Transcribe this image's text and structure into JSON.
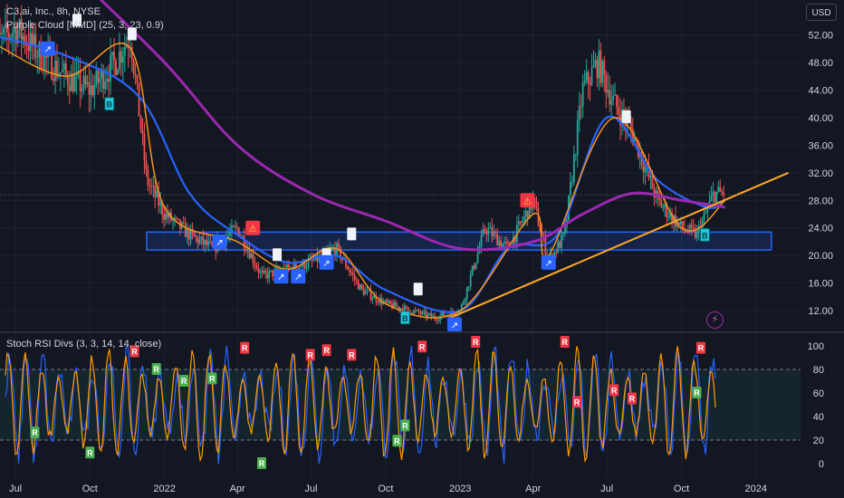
{
  "header": {
    "symbol_line": "C3.ai, Inc., 8h, NYSE",
    "indicator_line": "Purple Cloud [MMD] (25, 3, 23, 0.9)",
    "rsi_line": "Stoch RSI Divs (3, 3, 14, 14, close)"
  },
  "currency_button": "USD",
  "colors": {
    "background": "#131722",
    "up": "#26a69a",
    "down": "#ef5350",
    "blue_line": "#2962ff",
    "orange_line": "#f7931a",
    "purple_line": "#9c27b0",
    "trendline": "#ffa726",
    "zone": "#2962ff",
    "k_line": "#2962ff",
    "d_line": "#ff9800",
    "bull_div": "#4caf50",
    "bear_div": "#f23645"
  },
  "icons": [
    "rocket-icon",
    "bitcoin-icon",
    "lightning-icon"
  ],
  "chart_data": [
    {
      "type": "candlestick",
      "axis": "price",
      "ylim": [
        9,
        56
      ],
      "y_ticks": [
        "52.00",
        "48.00",
        "44.00",
        "40.00",
        "36.00",
        "32.00",
        "28.00",
        "24.00",
        "20.00",
        "16.00",
        "12.00"
      ],
      "x_ticks": [
        "Jul",
        "Oct",
        "2022",
        "Apr",
        "Jul",
        "Oct",
        "2023",
        "Apr",
        "Jul",
        "Oct",
        "2024"
      ],
      "x_range": [
        "2021-06",
        "2024-02"
      ],
      "price_path": [
        [
          "2021-06-01",
          50
        ],
        [
          "2021-07-01",
          53
        ],
        [
          "2021-08-01",
          49
        ],
        [
          "2021-09-01",
          46
        ],
        [
          "2021-10-01",
          44
        ],
        [
          "2021-11-01",
          48
        ],
        [
          "2021-11-20",
          52
        ],
        [
          "2021-12-10",
          31
        ],
        [
          "2022-01-01",
          26
        ],
        [
          "2022-02-01",
          23
        ],
        [
          "2022-03-01",
          21
        ],
        [
          "2022-04-01",
          24
        ],
        [
          "2022-05-01",
          17
        ],
        [
          "2022-06-01",
          18
        ],
        [
          "2022-07-01",
          19
        ],
        [
          "2022-08-01",
          21
        ],
        [
          "2022-09-01",
          15
        ],
        [
          "2022-10-01",
          13
        ],
        [
          "2022-11-01",
          12
        ],
        [
          "2022-12-01",
          11
        ],
        [
          "2023-01-01",
          12
        ],
        [
          "2023-02-01",
          24
        ],
        [
          "2023-03-01",
          21
        ],
        [
          "2023-04-01",
          28
        ],
        [
          "2023-04-20",
          19
        ],
        [
          "2023-05-10",
          23
        ],
        [
          "2023-06-01",
          44
        ],
        [
          "2023-06-20",
          48
        ],
        [
          "2023-07-10",
          42
        ],
        [
          "2023-08-01",
          38
        ],
        [
          "2023-09-01",
          28
        ],
        [
          "2023-10-01",
          24
        ],
        [
          "2023-10-20",
          23
        ],
        [
          "2023-11-10",
          29
        ],
        [
          "2023-11-24",
          29
        ]
      ],
      "lines": [
        {
          "name": "",
          "color": "#2962ff",
          "points": [
            [
              "2021-06-01",
              52
            ],
            [
              "2021-09-01",
              49
            ],
            [
              "2021-12-01",
              43
            ],
            [
              "2022-02-01",
              29
            ],
            [
              "2022-04-01",
              23
            ],
            [
              "2022-06-01",
              19
            ],
            [
              "2022-08-01",
              20
            ],
            [
              "2022-10-01",
              15
            ],
            [
              "2023-01-01",
              12
            ],
            [
              "2023-03-01",
              21
            ],
            [
              "2023-05-01",
              23
            ],
            [
              "2023-07-01",
              40
            ],
            [
              "2023-09-01",
              31
            ],
            [
              "2023-11-01",
              27
            ],
            [
              "2023-11-24",
              28
            ]
          ]
        },
        {
          "name": "",
          "color": "#f7931a",
          "points": [
            [
              "2021-06-01",
              51
            ],
            [
              "2021-09-01",
              46
            ],
            [
              "2021-11-20",
              50
            ],
            [
              "2022-01-01",
              27
            ],
            [
              "2022-04-01",
              22
            ],
            [
              "2022-06-01",
              18
            ],
            [
              "2022-08-01",
              21
            ],
            [
              "2022-10-01",
              13
            ],
            [
              "2023-01-01",
              12
            ],
            [
              "2023-04-01",
              26
            ],
            [
              "2023-04-20",
              20
            ],
            [
              "2023-07-10",
              40
            ],
            [
              "2023-10-01",
              24
            ],
            [
              "2023-11-24",
              28
            ]
          ]
        },
        {
          "name": "",
          "color": "#9c27b0",
          "points": [
            [
              "2021-09-01",
              62
            ],
            [
              "2022-01-01",
              48
            ],
            [
              "2022-04-01",
              36
            ],
            [
              "2022-07-01",
              29
            ],
            [
              "2022-10-01",
              25
            ],
            [
              "2023-01-01",
              21
            ],
            [
              "2023-04-01",
              22
            ],
            [
              "2023-06-01",
              26
            ],
            [
              "2023-08-01",
              29
            ],
            [
              "2023-10-01",
              28
            ],
            [
              "2023-11-24",
              27
            ]
          ]
        }
      ],
      "trendline": [
        [
          "2022-12-20",
          11
        ],
        [
          "2024-02-10",
          32
        ]
      ],
      "support_zone": {
        "from": "2021-12-10",
        "to": "2024-01-20",
        "low": 20.8,
        "high": 23.4
      },
      "current_price": 28.8,
      "markers": [
        {
          "icon": "rocket",
          "date": "2021-08-10",
          "price": 50
        },
        {
          "icon": "flag",
          "date": "2021-09-15",
          "price": 54
        },
        {
          "icon": "bitcoin",
          "date": "2021-10-25",
          "price": 42
        },
        {
          "icon": "flag",
          "date": "2021-11-22",
          "price": 52
        },
        {
          "icon": "rocket",
          "date": "2022-03-10",
          "price": 22
        },
        {
          "icon": "warn",
          "date": "2022-04-20",
          "price": 24
        },
        {
          "icon": "flag",
          "date": "2022-05-20",
          "price": 20
        },
        {
          "icon": "rocket",
          "date": "2022-05-25",
          "price": 17
        },
        {
          "icon": "rocket",
          "date": "2022-06-15",
          "price": 17
        },
        {
          "icon": "flag",
          "date": "2022-07-20",
          "price": 20
        },
        {
          "icon": "rocket",
          "date": "2022-07-20",
          "price": 19
        },
        {
          "icon": "flag",
          "date": "2022-08-20",
          "price": 23
        },
        {
          "icon": "flag",
          "date": "2022-11-10",
          "price": 15
        },
        {
          "icon": "bitcoin",
          "date": "2022-10-25",
          "price": 11
        },
        {
          "icon": "rocket",
          "date": "2022-12-25",
          "price": 10
        },
        {
          "icon": "warn",
          "date": "2023-03-25",
          "price": 28
        },
        {
          "icon": "rocket",
          "date": "2023-04-20",
          "price": 19
        },
        {
          "icon": "flag",
          "date": "2023-07-25",
          "price": 40
        },
        {
          "icon": "bitcoin",
          "date": "2023-10-30",
          "price": 23
        }
      ]
    },
    {
      "type": "line",
      "axis": "stoch_rsi",
      "ylim": [
        0,
        100
      ],
      "y_ticks": [
        "100",
        "80",
        "60",
        "40",
        "20",
        "0"
      ],
      "bands": [
        20,
        80
      ],
      "series": [
        {
          "name": "",
          "color": "#2962ff"
        },
        {
          "name": "",
          "color": "#ff9800"
        }
      ],
      "labels": [
        {
          "text": "R",
          "kind": "bear",
          "date": "2021-11-25",
          "value": 95
        },
        {
          "text": "R",
          "kind": "bull",
          "date": "2021-12-22",
          "value": 80
        },
        {
          "text": "R",
          "kind": "bull",
          "date": "2022-01-25",
          "value": 70
        },
        {
          "text": "R",
          "kind": "bull",
          "date": "2022-03-01",
          "value": 72
        },
        {
          "text": "R",
          "kind": "bear",
          "date": "2022-04-10",
          "value": 98
        },
        {
          "text": "R",
          "kind": "bear",
          "date": "2022-06-30",
          "value": 92
        },
        {
          "text": "R",
          "kind": "bear",
          "date": "2022-07-20",
          "value": 96
        },
        {
          "text": "R",
          "kind": "bear",
          "date": "2022-08-20",
          "value": 92
        },
        {
          "text": "R",
          "kind": "bull",
          "date": "2022-10-25",
          "value": 32
        },
        {
          "text": "R",
          "kind": "bull",
          "date": "2022-10-15",
          "value": 19
        },
        {
          "text": "R",
          "kind": "bull",
          "date": "2021-07-25",
          "value": 26
        },
        {
          "text": "R",
          "kind": "bull",
          "date": "2021-10-01",
          "value": 9
        },
        {
          "text": "R",
          "kind": "bull",
          "date": "2022-05-01",
          "value": 0
        },
        {
          "text": "R",
          "kind": "bear",
          "date": "2022-11-15",
          "value": 99
        },
        {
          "text": "R",
          "kind": "bear",
          "date": "2023-01-20",
          "value": 104
        },
        {
          "text": "R",
          "kind": "bear",
          "date": "2023-05-10",
          "value": 104
        },
        {
          "text": "R",
          "kind": "bear",
          "date": "2023-05-25",
          "value": 52
        },
        {
          "text": "R",
          "kind": "bear",
          "date": "2023-07-10",
          "value": 62
        },
        {
          "text": "R",
          "kind": "bear",
          "date": "2023-08-01",
          "value": 55
        },
        {
          "text": "R",
          "kind": "bull",
          "date": "2023-10-20",
          "value": 60
        },
        {
          "text": "R",
          "kind": "bear",
          "date": "2023-10-25",
          "value": 98
        }
      ]
    }
  ]
}
